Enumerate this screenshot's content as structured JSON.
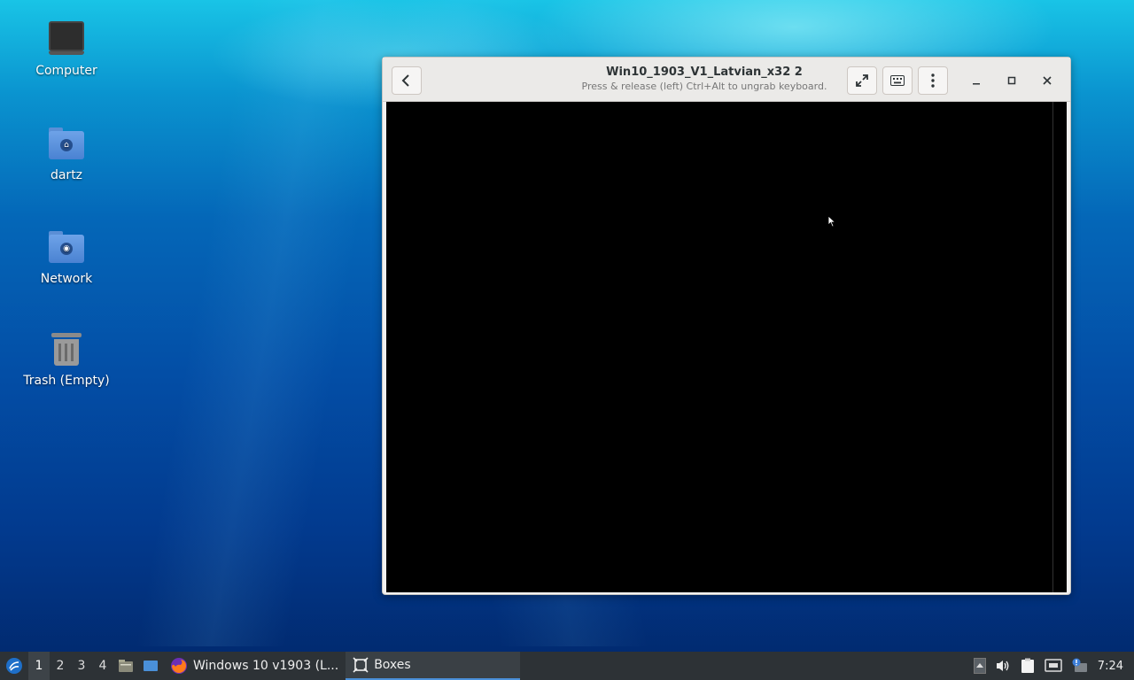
{
  "desktop": {
    "icons": [
      {
        "label": "Computer",
        "icon": "computer-icon"
      },
      {
        "label": "dartz",
        "icon": "home-folder-icon"
      },
      {
        "label": "Network",
        "icon": "network-folder-icon"
      },
      {
        "label": "Trash (Empty)",
        "icon": "trash-icon"
      }
    ]
  },
  "window": {
    "title": "Win10_1903_V1_Latvian_x32 2",
    "subtitle": "Press & release (left) Ctrl+Alt to ungrab keyboard.",
    "buttons": {
      "back": "back-arrow-icon",
      "fullscreen": "fullscreen-icon",
      "keyboard": "keyboard-icon",
      "menu": "kebab-menu-icon",
      "minimize": "minimize-icon",
      "maximize": "maximize-icon",
      "close": "close-icon"
    }
  },
  "taskbar": {
    "workspaces": [
      "1",
      "2",
      "3",
      "4"
    ],
    "active_workspace": "1",
    "tasks": [
      {
        "label": "Windows 10 v1903 (L...",
        "icon": "firefox-icon"
      },
      {
        "label": "Boxes",
        "icon": "boxes-icon",
        "active": true
      }
    ],
    "clock": "7:24"
  },
  "colors": {
    "taskbar": "#2d3236",
    "accent": "#4a90d9",
    "vm_screen": "#000000"
  }
}
